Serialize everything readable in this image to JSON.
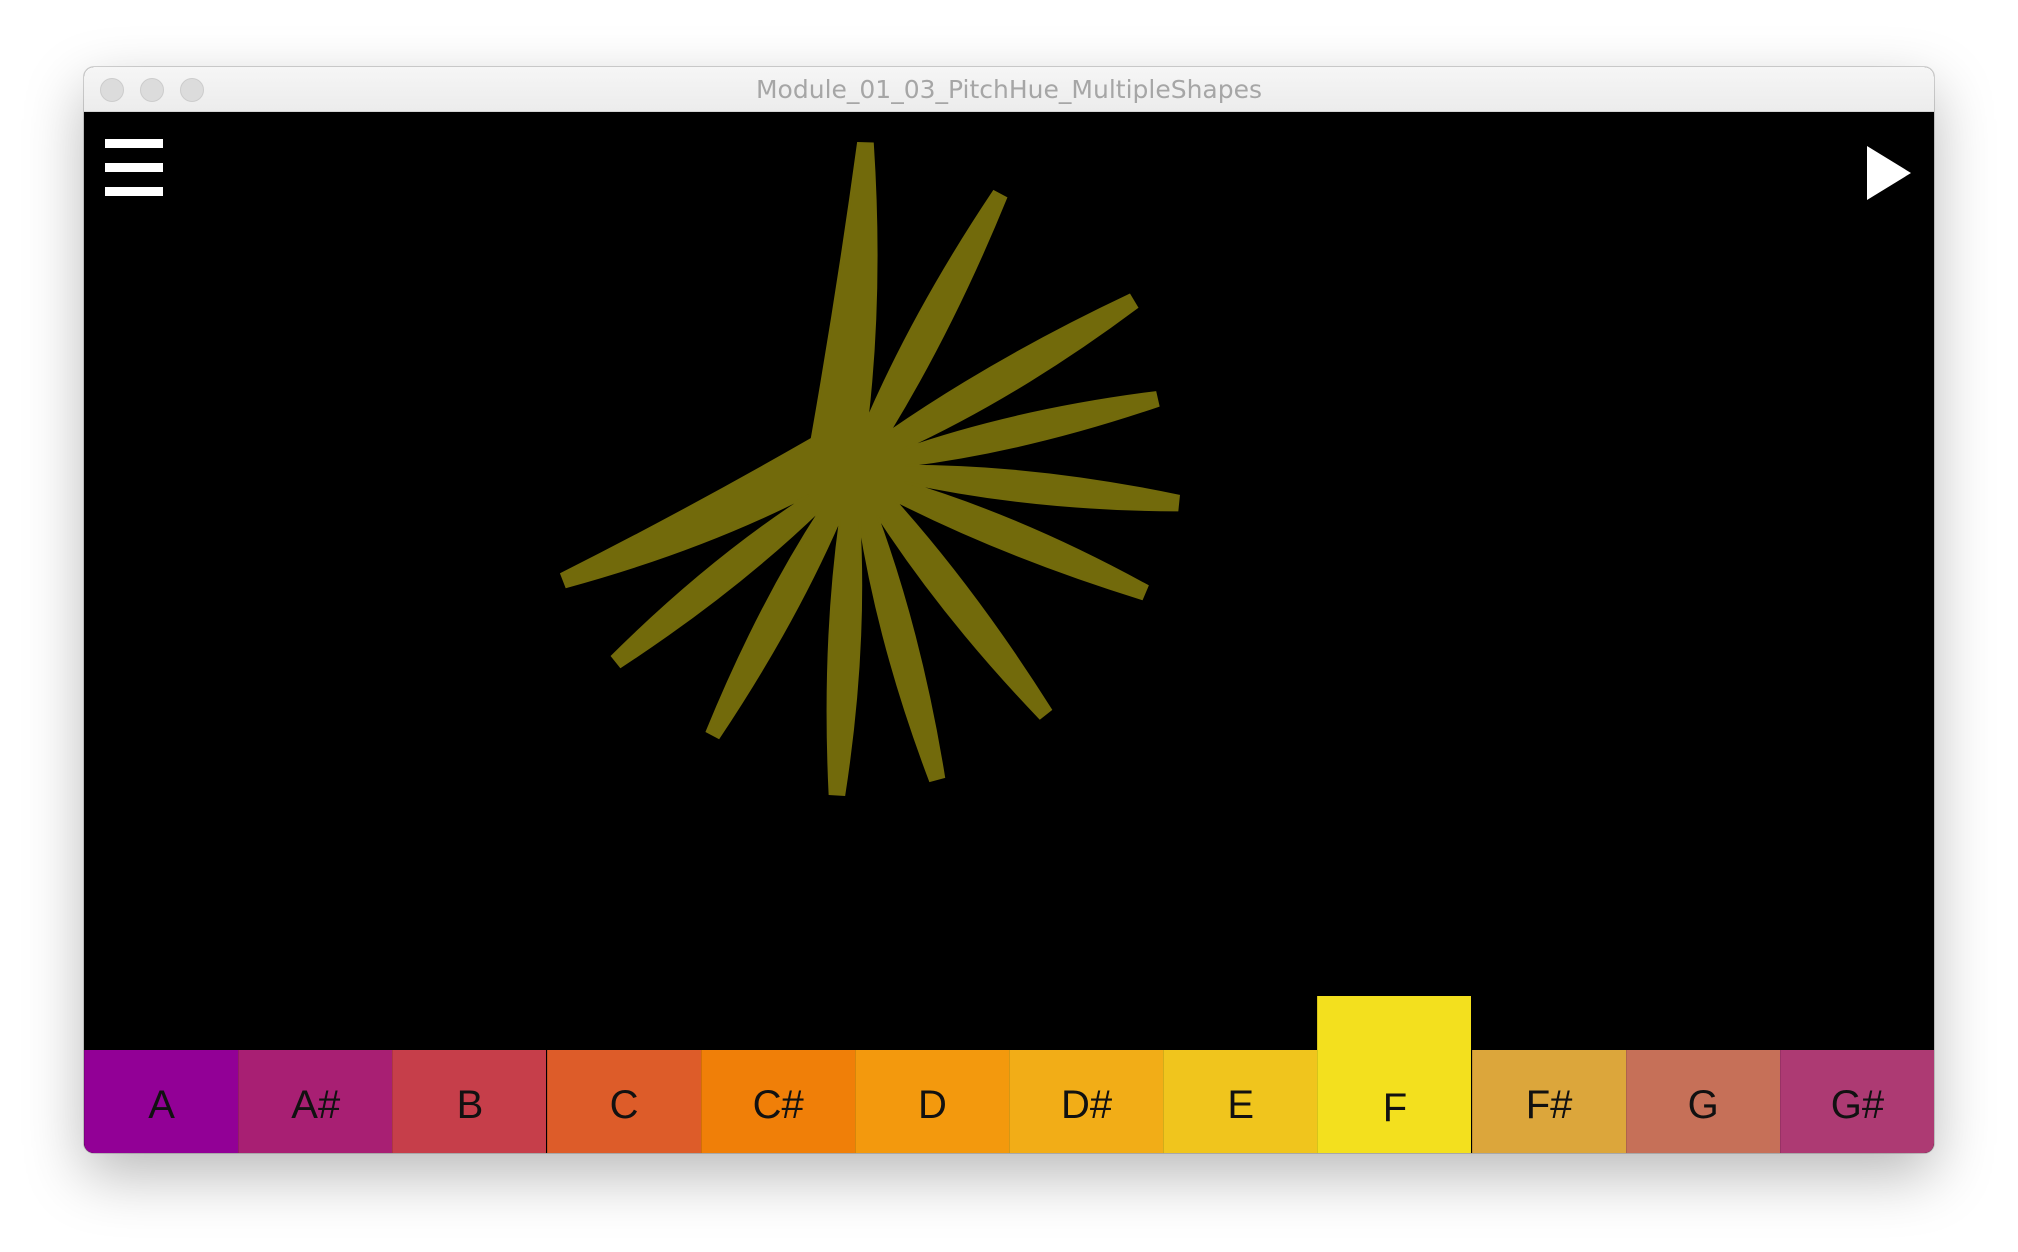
{
  "window": {
    "title": "Module_01_03_PitchHue_MultipleShapes"
  },
  "toolbar": {
    "menu_icon": "hamburger-menu-icon",
    "play_icon": "play-icon"
  },
  "shape": {
    "type": "12-point-star",
    "color": "#726a0b"
  },
  "keyboard": {
    "active_key": "F",
    "keys": [
      {
        "label": "A",
        "color": "#920096"
      },
      {
        "label": "A#",
        "color": "#a81f73"
      },
      {
        "label": "B",
        "color": "#c63e4a"
      },
      {
        "label": "C",
        "color": "#dd5c29"
      },
      {
        "label": "C#",
        "color": "#f07f08"
      },
      {
        "label": "D",
        "color": "#f3990d"
      },
      {
        "label": "D#",
        "color": "#f2ad17"
      },
      {
        "label": "E",
        "color": "#f0c51d"
      },
      {
        "label": "F",
        "color": "#f3e01e"
      },
      {
        "label": "F#",
        "color": "#dca63b"
      },
      {
        "label": "G",
        "color": "#c67058"
      },
      {
        "label": "G#",
        "color": "#ad3a73"
      }
    ]
  }
}
